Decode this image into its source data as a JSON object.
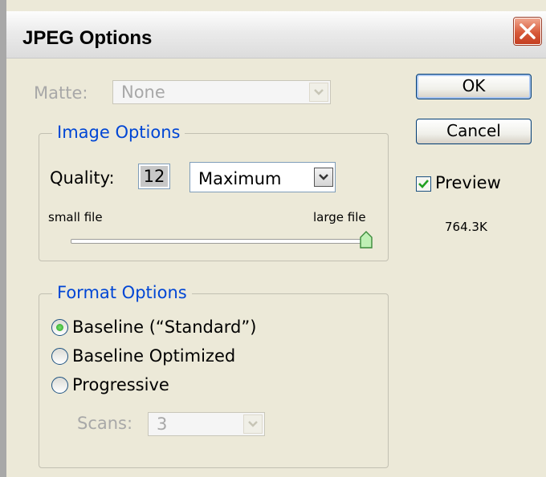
{
  "dialog": {
    "title": "JPEG Options"
  },
  "matte": {
    "label": "Matte:",
    "value": "None"
  },
  "image_options": {
    "legend": "Image Options",
    "quality_label": "Quality:",
    "quality_value": "12",
    "quality_preset": "Maximum",
    "slider_min_label": "small file",
    "slider_max_label": "large file",
    "slider_level": 1.0
  },
  "format_options": {
    "legend": "Format Options",
    "options": [
      {
        "label": "Baseline (“Standard”)",
        "selected": true
      },
      {
        "label": "Baseline Optimized",
        "selected": false
      },
      {
        "label": "Progressive",
        "selected": false
      }
    ],
    "scans_label": "Scans:",
    "scans_value": "3"
  },
  "buttons": {
    "ok": "OK",
    "cancel": "Cancel"
  },
  "preview": {
    "label": "Preview",
    "checked": true,
    "file_size": "764.3K"
  },
  "colors": {
    "accent": "#0046d5",
    "close": "#d85a3a",
    "radio_dot": "#21a121",
    "check": "#21a121"
  }
}
